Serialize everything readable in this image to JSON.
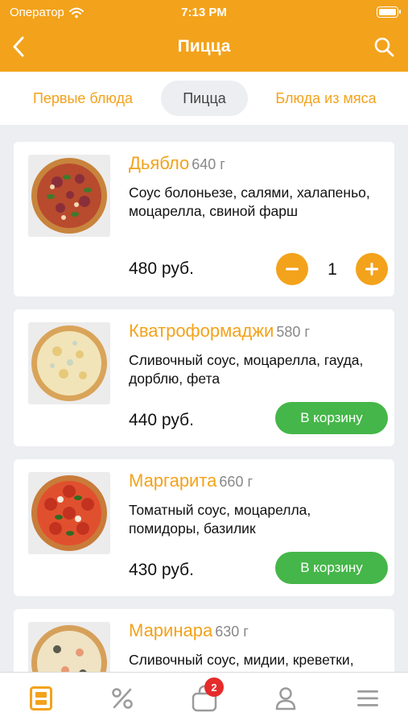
{
  "status_bar": {
    "carrier": "Оператор",
    "time": "7:13 PM"
  },
  "nav": {
    "title": "Пицца",
    "back_icon": "chevron-left-icon",
    "search_icon": "search-icon"
  },
  "categories": [
    {
      "label": "Первые блюда",
      "active": false
    },
    {
      "label": "Пицца",
      "active": true
    },
    {
      "label": "Блюда из мяса",
      "active": false
    }
  ],
  "products": [
    {
      "name": "Дьябло",
      "weight": "640 г",
      "description": "Соус болоньезе, салями, халапеньо, моцарелла, свиной фарш",
      "price": "480 руб.",
      "quantity": "1",
      "in_cart": true
    },
    {
      "name": "Кватроформаджи",
      "weight": "580 г",
      "description": "Сливочный соус, моцарелла, гауда, дорблю, фета",
      "price": "440 руб.",
      "button": "В корзину",
      "in_cart": false
    },
    {
      "name": "Маргарита",
      "weight": "660 г",
      "description": "Томатный соус, моцарелла, помидоры, базилик",
      "price": "430 руб.",
      "button": "В корзину",
      "in_cart": false
    },
    {
      "name": "Маринара",
      "weight": "630 г",
      "description": "Сливочный соус, мидии, креветки,",
      "in_cart": false
    }
  ],
  "tabbar": {
    "items": [
      "menu-icon",
      "percent-icon",
      "cart-icon",
      "profile-icon",
      "hamburger-icon"
    ],
    "cart_badge": "2"
  },
  "colors": {
    "accent": "#f3a21b",
    "green": "#45b649",
    "badge": "#e52b2b",
    "background": "#eceef1"
  }
}
